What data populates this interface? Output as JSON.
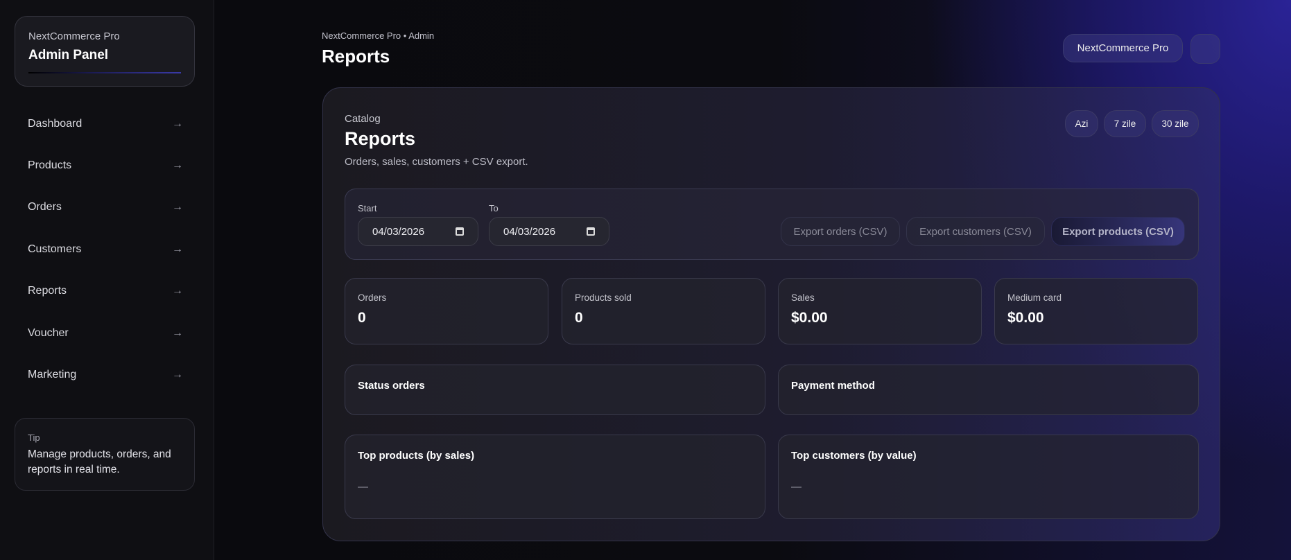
{
  "sidebar": {
    "brand_sub": "NextCommerce Pro",
    "brand_title": "Admin Panel",
    "items": [
      {
        "label": "Dashboard",
        "arrow": "→"
      },
      {
        "label": "Products",
        "arrow": "→"
      },
      {
        "label": "Orders",
        "arrow": "→"
      },
      {
        "label": "Customers",
        "arrow": "→"
      },
      {
        "label": "Reports",
        "arrow": "→"
      },
      {
        "label": "Voucher",
        "arrow": "→"
      },
      {
        "label": "Marketing",
        "arrow": "→"
      }
    ],
    "tip_label": "Tip",
    "tip_text": "Manage products, orders, and reports in real time."
  },
  "header": {
    "breadcrumb": "NextCommerce Pro • Admin",
    "title": "Reports",
    "store_pill": "NextCommerce Pro"
  },
  "main": {
    "section": "Catalog",
    "title": "Reports",
    "subtitle": "Orders, sales, customers + CSV export.",
    "periods": [
      "Azi",
      "7 zile",
      "30 zile"
    ],
    "filters": {
      "start_label": "Start",
      "start_value": "04/03/2026",
      "to_label": "To",
      "to_value": "04/03/2026"
    },
    "exports": [
      "Export orders (CSV)",
      "Export customers (CSV)",
      "Export products (CSV)"
    ],
    "stats": [
      {
        "label": "Orders",
        "value": "0"
      },
      {
        "label": "Products sold",
        "value": "0"
      },
      {
        "label": "Sales",
        "value": "$0.00"
      },
      {
        "label": "Medium card",
        "value": "$0.00"
      }
    ],
    "panels": {
      "status": "Status orders",
      "payment": "Payment method",
      "top_products": "Top products (by sales)",
      "top_products_empty": "—",
      "top_customers": "Top customers (by value)",
      "top_customers_empty": "—"
    }
  }
}
